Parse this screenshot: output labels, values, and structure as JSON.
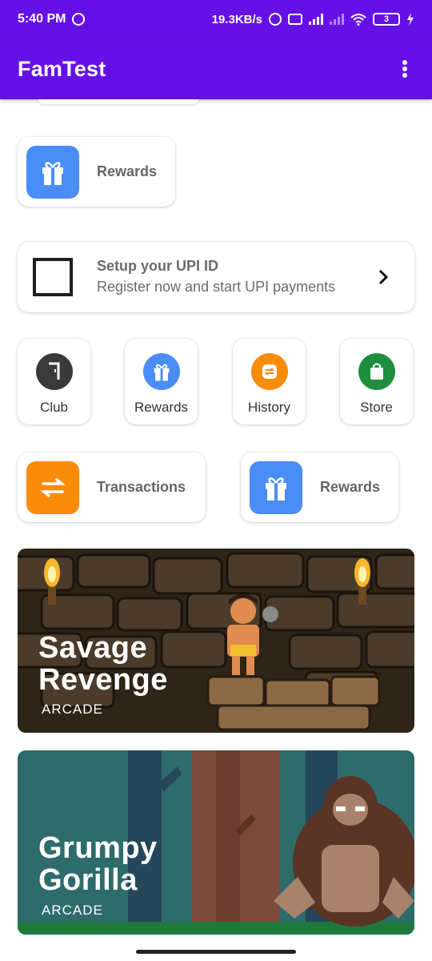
{
  "status_bar": {
    "time": "5:40 PM",
    "net_speed": "19.3KB/s",
    "battery": "3"
  },
  "app_bar": {
    "title": "FamTest",
    "menu_icon": "more-vert-icon"
  },
  "rewards_card": {
    "label": "Rewards",
    "icon": "gift-icon"
  },
  "upi_card": {
    "title": "Setup your UPI ID",
    "subtitle": "Register now and start UPI payments",
    "icon": "square-icon",
    "chevron": "chevron-right-icon"
  },
  "quick_actions": [
    {
      "label": "Club",
      "icon": "club-icon",
      "color": "#3a3a3a"
    },
    {
      "label": "Rewards",
      "icon": "gift-icon",
      "color": "#4a8df6"
    },
    {
      "label": "History",
      "icon": "history-icon",
      "color": "#fb8b0a"
    },
    {
      "label": "Store",
      "icon": "bag-icon",
      "color": "#1e8e3e"
    }
  ],
  "wide_cards": [
    {
      "label": "Transactions",
      "icon": "swap-icon",
      "color": "#fb8b0a"
    },
    {
      "label": "Rewards",
      "icon": "gift-icon",
      "color": "#4a8df6"
    }
  ],
  "games": [
    {
      "title_line1": "Savage",
      "title_line2": "Revenge",
      "category": "ARCADE"
    },
    {
      "title_line1": "Grumpy",
      "title_line2": "Gorilla",
      "category": "ARCADE"
    }
  ]
}
